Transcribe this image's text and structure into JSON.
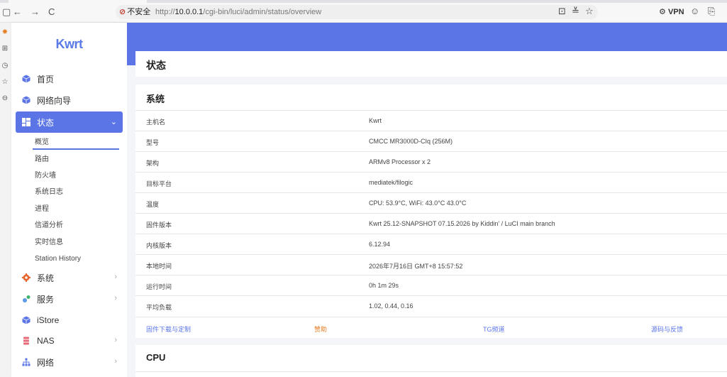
{
  "browser": {
    "back": "←",
    "forward": "→",
    "reload": "C",
    "insecure_label": "不安全",
    "url_prefix": "http://",
    "url_host": "10.0.0.1",
    "url_path": "/cgi-bin/luci/admin/status/overview",
    "vpn_label": "VPN"
  },
  "app": {
    "logo": "Kwrt",
    "page_title": "状态"
  },
  "sidebar": {
    "items": [
      {
        "label": "首页",
        "icon": "cube-icon"
      },
      {
        "label": "网络向导",
        "icon": "cube-icon"
      },
      {
        "label": "状态",
        "icon": "dashboard-icon"
      },
      {
        "label": "系统",
        "icon": "gear-icon"
      },
      {
        "label": "服务",
        "icon": "services-icon"
      },
      {
        "label": "iStore",
        "icon": "cube-icon"
      },
      {
        "label": "NAS",
        "icon": "storage-icon"
      },
      {
        "label": "网络",
        "icon": "network-icon"
      }
    ],
    "status_submenu": [
      "概览",
      "路由",
      "防火墙",
      "系统日志",
      "进程",
      "信道分析",
      "实时信息",
      "Station History"
    ]
  },
  "system": {
    "heading": "系统",
    "rows": [
      {
        "key": "主机名",
        "value": "Kwrt"
      },
      {
        "key": "型号",
        "value": "CMCC MR3000D-CIq (256M)"
      },
      {
        "key": "架构",
        "value": "ARMv8 Processor x 2"
      },
      {
        "key": "目标平台",
        "value": "mediatek/filogic"
      },
      {
        "key": "温度",
        "value": "CPU: 53.9°C, WiFi: 43.0°C 43.0°C"
      },
      {
        "key": "固件版本",
        "value": "Kwrt 25.12-SNAPSHOT 07.15.2026 by Kiddin' / LuCI main branch"
      },
      {
        "key": "内核版本",
        "value": "6.12.94"
      },
      {
        "key": "本地时间",
        "value": "2026年7月16日 GMT+8 15:57:52"
      },
      {
        "key": "运行时间",
        "value": "0h 1m 29s"
      },
      {
        "key": "平均负载",
        "value": "1.02, 0.44, 0.16"
      }
    ],
    "links": [
      "固件下载与定制",
      "赞助",
      "TG频道",
      "源码与反馈"
    ]
  },
  "cpu": {
    "heading": "CPU"
  },
  "colors": {
    "accent": "#5b75e6",
    "donate": "#e67e22",
    "background": "#f4f5f8"
  }
}
